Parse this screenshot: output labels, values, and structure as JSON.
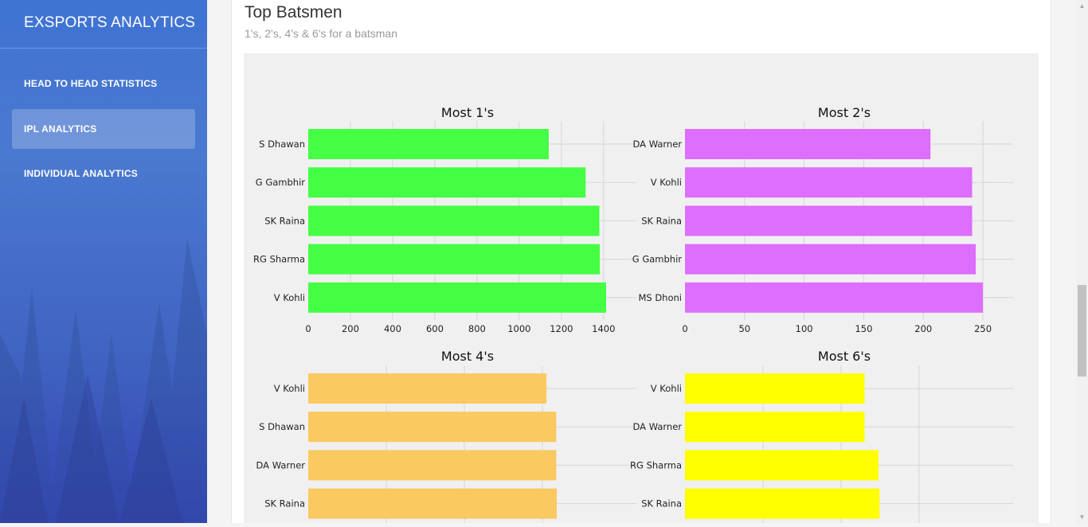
{
  "sidebar": {
    "brand": "EXSPORTS ANALYTICS",
    "items": [
      {
        "label": "HEAD TO HEAD STATISTICS",
        "active": false
      },
      {
        "label": "IPL ANALYTICS",
        "active": true
      },
      {
        "label": "INDIVIDUAL ANALYTICS",
        "active": false
      }
    ]
  },
  "section": {
    "title": "Top Batsmen",
    "subtitle": "1's, 2's, 4's & 6's for a batsman"
  },
  "chart_data": [
    {
      "type": "bar",
      "orientation": "horizontal",
      "title": "Most 1's",
      "color": "#44ff44",
      "categories": [
        "S Dhawan",
        "G Gambhir",
        "SK Raina",
        "RG Sharma",
        "V Kohli"
      ],
      "values": [
        1140,
        1315,
        1380,
        1382,
        1412
      ],
      "xticks": [
        0,
        200,
        400,
        600,
        800,
        1000,
        1200,
        1400
      ],
      "xlim": [
        0,
        1480
      ],
      "grid": true
    },
    {
      "type": "bar",
      "orientation": "horizontal",
      "title": "Most 2's",
      "color": "#dd6eff",
      "categories": [
        "DA Warner",
        "V Kohli",
        "SK Raina",
        "G Gambhir",
        "MS Dhoni"
      ],
      "values": [
        206,
        241,
        241,
        244,
        250
      ],
      "xticks": [
        0,
        50,
        100,
        150,
        200,
        250
      ],
      "xlim": [
        0,
        262
      ],
      "grid": true
    },
    {
      "type": "bar",
      "orientation": "horizontal",
      "title": "Most 4's",
      "color": "#fac960",
      "categories": [
        "V Kohli",
        "S Dhawan",
        "DA Warner",
        "SK Raina"
      ],
      "values": [
        460,
        479,
        479,
        480
      ],
      "xlim": [
        0,
        603
      ],
      "grid": true
    },
    {
      "type": "bar",
      "orientation": "horizontal",
      "title": "Most 6's",
      "color": "#ffff00",
      "categories": [
        "V Kohli",
        "DA Warner",
        "RG Sharma",
        "SK Raina"
      ],
      "values": [
        180,
        180,
        194,
        195
      ],
      "xlim": [
        0,
        313
      ],
      "grid": true
    }
  ]
}
